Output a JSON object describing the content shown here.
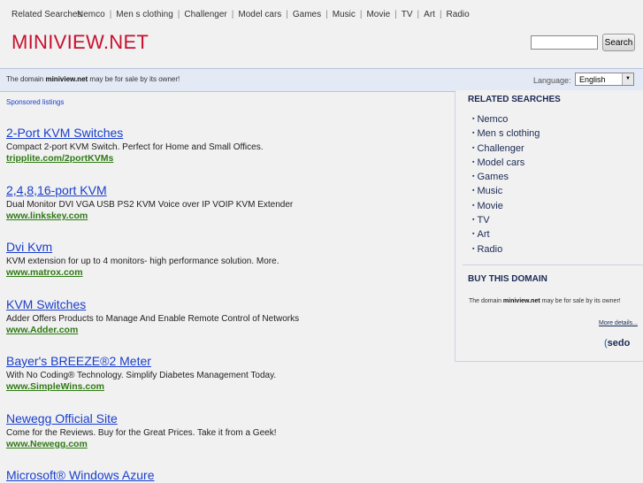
{
  "topbar": {
    "related_label": "Related Searches",
    "links": [
      "Nemco",
      "Men s clothing",
      "Challenger",
      "Model cars",
      "Games",
      "Music",
      "Movie",
      "TV",
      "Art",
      "Radio"
    ]
  },
  "logo": "MINIVIEW.NET",
  "search": {
    "button_label": "Search",
    "value": ""
  },
  "infobar": {
    "message_prefix": "The domain ",
    "domain": "miniview.net",
    "message_suffix": " may be for sale by its owner!",
    "language_label": "Language:",
    "language_value": "English"
  },
  "sponsored_label": "Sponsored listings",
  "listings": [
    {
      "title": "2-Port KVM Switches",
      "desc": "Compact 2-port KVM Switch. Perfect for Home and Small Offices.",
      "url": "tripplite.com/2portKVMs"
    },
    {
      "title": "2,4,8,16-port KVM",
      "desc": "Dual Monitor DVI VGA USB PS2 KVM Voice over IP VOIP KVM Extender",
      "url": "www.linkskey.com"
    },
    {
      "title": "Dvi Kvm",
      "desc": "KVM extension for up to 4 monitors- high performance solution. More.",
      "url": "www.matrox.com"
    },
    {
      "title": "KVM Switches",
      "desc": "Adder Offers Products to Manage And Enable Remote Control of Networks",
      "url": "www.Adder.com"
    },
    {
      "title": "Bayer's BREEZE®2 Meter",
      "desc": "With No Coding® Technology. Simplify Diabetes Management Today.",
      "url": "www.SimpleWins.com"
    },
    {
      "title": "Newegg Official Site",
      "desc": "Come for the Reviews. Buy for the Great Prices. Take it from a Geek!",
      "url": "www.Newegg.com"
    },
    {
      "title": "Microsoft® Windows Azure",
      "desc": "",
      "url": ""
    }
  ],
  "sidebar": {
    "related_heading": "RELATED SEARCHES",
    "items": [
      "Nemco",
      "Men s clothing",
      "Challenger",
      "Model cars",
      "Games",
      "Music",
      "Movie",
      "TV",
      "Art",
      "Radio"
    ],
    "buy_heading": "BUY THIS DOMAIN",
    "buy_prefix": "The domain ",
    "buy_domain": "miniview.net",
    "buy_suffix": " may be for sale by its owner!",
    "more_details": "More details...",
    "sedo_logo": "sedo"
  }
}
